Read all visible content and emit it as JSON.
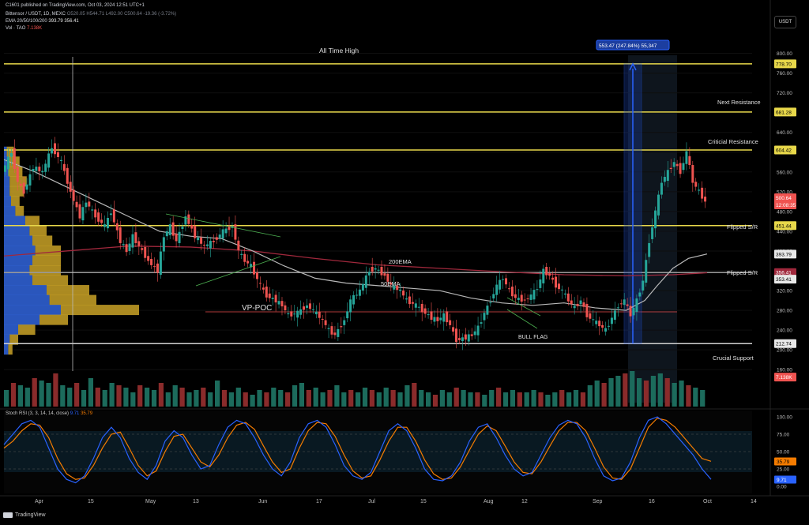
{
  "header": {
    "publisher": "C1601 published on TradingView.com, Oct 03, 2024 12:51 UTC+1",
    "symbol": "Bittensor / USDT, 1D, MEXC",
    "ohlc": "O520.05 H544.71 L492.00 C500.64 -19.36 (-3.72%)",
    "ema_label": "EMA 20/50/100/200",
    "ema_values": "393.79 356.41",
    "vol_label": "Vol · TAO",
    "vol_value": "7.138K",
    "currency": "USDT"
  },
  "annotations": {
    "ath": "All Time High",
    "next_res": "Next Resistance",
    "crit_res": "Criticial Resistance",
    "flipped1": "Flipped S/R",
    "flipped2": "Flipped S/R",
    "crucial": "Crucial Support",
    "ema200": "200EMA",
    "ema50": "50EMA",
    "vppoc": "VP-POC",
    "bullflag": "BULL FLAG",
    "measure": "553.47 (247.84%) 55,347"
  },
  "stoch": {
    "label": "Stoch RSI (3, 3, 14, 14, close)",
    "k_value": "9.71",
    "d_value": "35.79"
  },
  "footer": {
    "brand": "TradingView"
  },
  "colors": {
    "up": "#26a69a",
    "down": "#ef5350",
    "level": "#e8d84a",
    "ema50": "#b8b8b8",
    "ema200": "#a0283c",
    "vp_blue": "#2f5fd0",
    "vp_gold": "#c9a227",
    "stoch_k": "#2962ff",
    "stoch_d": "#f57c00"
  },
  "chart_data": {
    "type": "candlestick",
    "timeframe": "1D",
    "x_ticks": [
      "Apr",
      "15",
      "May",
      "13",
      "Jun",
      "17",
      "Jul",
      "15",
      "Aug",
      "12",
      "Sep",
      "16",
      "Oct",
      "14"
    ],
    "price_ticks": [
      800.0,
      760.0,
      720.0,
      680.0,
      640.0,
      600.0,
      560.0,
      520.0,
      480.0,
      440.0,
      400.0,
      360.0,
      320.0,
      280.0,
      240.0,
      200.0,
      160.0
    ],
    "ylim": [
      130,
      820
    ],
    "levels": [
      {
        "name": "All Time High",
        "price": 778.7
      },
      {
        "name": "Next Resistance",
        "price": 681.28
      },
      {
        "name": "Criticial Resistance",
        "price": 604.42
      },
      {
        "name": "Flipped S/R",
        "price": 451.44
      },
      {
        "name": "Flipped S/R",
        "price": 356.41
      },
      {
        "name": "Crucial Support",
        "price": 212.74
      },
      {
        "name": "VP-POC",
        "price": 277
      }
    ],
    "price_labels": [
      {
        "label": "778.70",
        "price": 778.7
      },
      {
        "label": "681.28",
        "price": 681.28
      },
      {
        "label": "604.42",
        "price": 604.42
      },
      {
        "label": "500.64\n12:08:35",
        "price": 500.64
      },
      {
        "label": "451.44",
        "price": 451.44
      },
      {
        "label": "393.79",
        "price": 393.79
      },
      {
        "label": "356.41",
        "price": 356.41
      },
      {
        "label": "353.41",
        "price": 343
      },
      {
        "label": "212.74",
        "price": 212.74
      },
      {
        "label": "7.138K",
        "price": 145
      }
    ],
    "close_path": [
      [
        0,
        560
      ],
      [
        6,
        600
      ],
      [
        10,
        540
      ],
      [
        14,
        520
      ],
      [
        20,
        570
      ],
      [
        26,
        560
      ],
      [
        32,
        610
      ],
      [
        38,
        580
      ],
      [
        44,
        520
      ],
      [
        50,
        470
      ],
      [
        54,
        500
      ],
      [
        60,
        470
      ],
      [
        66,
        450
      ],
      [
        70,
        480
      ],
      [
        76,
        420
      ],
      [
        80,
        400
      ],
      [
        84,
        430
      ],
      [
        88,
        410
      ],
      [
        94,
        380
      ],
      [
        100,
        360
      ],
      [
        104,
        430
      ],
      [
        108,
        450
      ],
      [
        112,
        420
      ],
      [
        118,
        470
      ],
      [
        124,
        430
      ],
      [
        130,
        410
      ],
      [
        136,
        420
      ],
      [
        142,
        440
      ],
      [
        148,
        450
      ],
      [
        152,
        400
      ],
      [
        156,
        380
      ],
      [
        160,
        370
      ],
      [
        166,
        330
      ],
      [
        170,
        310
      ],
      [
        176,
        300
      ],
      [
        180,
        290
      ],
      [
        184,
        270
      ],
      [
        190,
        275
      ],
      [
        196,
        290
      ],
      [
        200,
        280
      ],
      [
        206,
        260
      ],
      [
        210,
        240
      ],
      [
        214,
        230
      ],
      [
        220,
        260
      ],
      [
        224,
        300
      ],
      [
        230,
        320
      ],
      [
        236,
        360
      ],
      [
        240,
        365
      ],
      [
        246,
        350
      ],
      [
        250,
        330
      ],
      [
        256,
        320
      ],
      [
        260,
        300
      ],
      [
        266,
        290
      ],
      [
        270,
        280
      ],
      [
        276,
        265
      ],
      [
        280,
        260
      ],
      [
        284,
        270
      ],
      [
        288,
        250
      ],
      [
        292,
        220
      ],
      [
        298,
        225
      ],
      [
        302,
        230
      ],
      [
        306,
        245
      ],
      [
        310,
        275
      ],
      [
        314,
        300
      ],
      [
        318,
        330
      ],
      [
        322,
        345
      ],
      [
        326,
        320
      ],
      [
        330,
        305
      ],
      [
        336,
        300
      ],
      [
        340,
        310
      ],
      [
        344,
        325
      ],
      [
        348,
        360
      ],
      [
        352,
        350
      ],
      [
        356,
        330
      ],
      [
        360,
        320
      ],
      [
        364,
        300
      ],
      [
        368,
        285
      ],
      [
        372,
        300
      ],
      [
        376,
        270
      ],
      [
        380,
        260
      ],
      [
        384,
        250
      ],
      [
        388,
        240
      ],
      [
        392,
        265
      ],
      [
        396,
        290
      ],
      [
        400,
        300
      ],
      [
        404,
        270
      ],
      [
        408,
        300
      ],
      [
        412,
        340
      ],
      [
        416,
        420
      ],
      [
        420,
        480
      ],
      [
        424,
        540
      ],
      [
        428,
        560
      ],
      [
        432,
        580
      ],
      [
        436,
        560
      ],
      [
        440,
        600
      ],
      [
        444,
        540
      ],
      [
        448,
        520
      ],
      [
        452,
        500
      ]
    ],
    "ema50_path": [
      [
        0,
        585
      ],
      [
        20,
        560
      ],
      [
        40,
        530
      ],
      [
        60,
        500
      ],
      [
        80,
        470
      ],
      [
        100,
        440
      ],
      [
        120,
        430
      ],
      [
        140,
        425
      ],
      [
        160,
        400
      ],
      [
        180,
        370
      ],
      [
        200,
        345
      ],
      [
        220,
        335
      ],
      [
        240,
        330
      ],
      [
        260,
        325
      ],
      [
        280,
        320
      ],
      [
        300,
        305
      ],
      [
        320,
        295
      ],
      [
        340,
        290
      ],
      [
        360,
        295
      ],
      [
        380,
        285
      ],
      [
        400,
        280
      ],
      [
        412,
        300
      ],
      [
        420,
        330
      ],
      [
        430,
        365
      ],
      [
        440,
        385
      ],
      [
        452,
        394
      ]
    ],
    "ema200_path": [
      [
        0,
        390
      ],
      [
        40,
        400
      ],
      [
        80,
        410
      ],
      [
        120,
        408
      ],
      [
        160,
        400
      ],
      [
        200,
        385
      ],
      [
        240,
        372
      ],
      [
        280,
        365
      ],
      [
        320,
        358
      ],
      [
        360,
        352
      ],
      [
        400,
        350
      ],
      [
        430,
        352
      ],
      [
        452,
        356
      ]
    ],
    "volume": [
      0.35,
      0.5,
      0.45,
      0.4,
      0.6,
      0.55,
      0.5,
      0.7,
      0.45,
      0.4,
      0.5,
      0.35,
      0.6,
      0.4,
      0.35,
      0.5,
      0.45,
      0.4,
      0.3,
      0.45,
      0.4,
      0.35,
      0.5,
      0.3,
      0.45,
      0.4,
      0.3,
      0.35,
      0.4,
      0.3,
      0.55,
      0.35,
      0.3,
      0.4,
      0.3,
      0.25,
      0.35,
      0.3,
      0.4,
      0.35,
      0.3,
      0.45,
      0.5,
      0.35,
      0.4,
      0.3,
      0.35,
      0.45,
      0.3,
      0.35,
      0.3,
      0.4,
      0.35,
      0.3,
      0.4,
      0.35,
      0.3,
      0.45,
      0.5,
      0.35,
      0.3,
      0.25,
      0.35,
      0.3,
      0.4,
      0.35,
      0.3,
      0.3,
      0.25,
      0.35,
      0.4,
      0.3,
      0.35,
      0.3,
      0.3,
      0.35,
      0.3,
      0.25,
      0.3,
      0.35,
      0.3,
      0.35,
      0.3,
      0.45,
      0.55,
      0.5,
      0.6,
      0.65,
      0.7,
      0.75,
      0.6,
      0.55,
      0.65,
      0.7,
      0.6,
      0.5,
      0.55,
      0.45,
      0.4,
      0.35
    ],
    "stoch_k": [
      60,
      75,
      90,
      95,
      85,
      55,
      25,
      10,
      5,
      15,
      40,
      70,
      85,
      70,
      40,
      20,
      10,
      30,
      65,
      80,
      70,
      45,
      25,
      30,
      60,
      85,
      95,
      90,
      70,
      45,
      25,
      15,
      35,
      70,
      90,
      95,
      85,
      60,
      30,
      15,
      10,
      20,
      50,
      80,
      90,
      80,
      55,
      25,
      10,
      8,
      15,
      35,
      65,
      85,
      90,
      70,
      45,
      25,
      15,
      20,
      45,
      70,
      88,
      95,
      90,
      70,
      40,
      15,
      8,
      12,
      35,
      70,
      95,
      100,
      90,
      75,
      60,
      45,
      25,
      10
    ],
    "stoch_d": [
      55,
      65,
      80,
      90,
      88,
      70,
      40,
      18,
      10,
      12,
      30,
      55,
      75,
      78,
      55,
      30,
      15,
      22,
      50,
      72,
      75,
      55,
      35,
      28,
      45,
      70,
      88,
      92,
      82,
      58,
      35,
      20,
      25,
      55,
      80,
      92,
      90,
      72,
      45,
      22,
      12,
      15,
      38,
      65,
      85,
      85,
      65,
      38,
      18,
      10,
      12,
      28,
      52,
      75,
      87,
      80,
      58,
      35,
      20,
      18,
      35,
      58,
      80,
      92,
      92,
      80,
      55,
      28,
      12,
      10,
      25,
      55,
      85,
      98,
      95,
      85,
      70,
      55,
      40,
      36
    ],
    "volume_profile": [
      {
        "price": 600,
        "blue": 0.02,
        "gold": 0.05
      },
      {
        "price": 580,
        "blue": 0.03,
        "gold": 0.08
      },
      {
        "price": 560,
        "blue": 0.03,
        "gold": 0.1
      },
      {
        "price": 540,
        "blue": 0.04,
        "gold": 0.12
      },
      {
        "price": 520,
        "blue": 0.04,
        "gold": 0.1
      },
      {
        "price": 500,
        "blue": 0.05,
        "gold": 0.06
      },
      {
        "price": 480,
        "blue": 0.08,
        "gold": 0.06
      },
      {
        "price": 460,
        "blue": 0.15,
        "gold": 0.1
      },
      {
        "price": 440,
        "blue": 0.18,
        "gold": 0.12
      },
      {
        "price": 420,
        "blue": 0.2,
        "gold": 0.14
      },
      {
        "price": 400,
        "blue": 0.22,
        "gold": 0.18
      },
      {
        "price": 380,
        "blue": 0.2,
        "gold": 0.2
      },
      {
        "price": 360,
        "blue": 0.18,
        "gold": 0.22
      },
      {
        "price": 340,
        "blue": 0.2,
        "gold": 0.25
      },
      {
        "price": 320,
        "blue": 0.3,
        "gold": 0.3
      },
      {
        "price": 300,
        "blue": 0.32,
        "gold": 0.33
      },
      {
        "price": 280,
        "blue": 0.4,
        "gold": 0.55
      },
      {
        "price": 260,
        "blue": 0.25,
        "gold": 0.2
      },
      {
        "price": 240,
        "blue": 0.1,
        "gold": 0.12
      },
      {
        "price": 220,
        "blue": 0.04,
        "gold": 0.06
      },
      {
        "price": 200,
        "blue": 0.03,
        "gold": 0.03
      }
    ],
    "stoch_levels": [
      {
        "label": "100.00",
        "value": 100
      },
      {
        "label": "75.00",
        "value": 75
      },
      {
        "label": "50.00",
        "value": 50
      },
      {
        "label": "25.00",
        "value": 25
      },
      {
        "label": "0.00",
        "value": 0
      }
    ]
  }
}
